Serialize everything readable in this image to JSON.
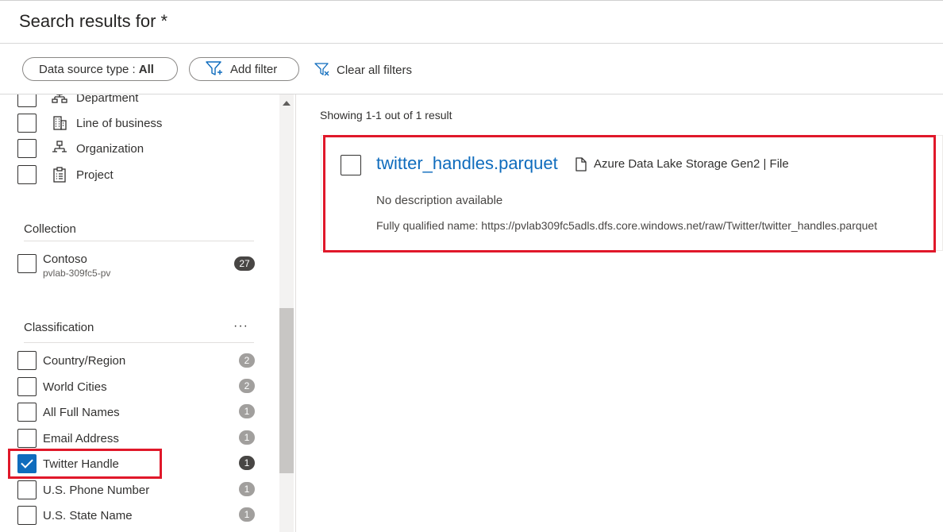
{
  "header": {
    "title": "Search results for *"
  },
  "toolbar": {
    "data_source_label": "Data source type : ",
    "data_source_value": "All",
    "add_filter": "Add filter",
    "clear_filters": "Clear all filters"
  },
  "sidebar": {
    "glossary_items": [
      {
        "label": "Department",
        "icon": "hierarchy-icon"
      },
      {
        "label": "Line of business",
        "icon": "building-icon"
      },
      {
        "label": "Organization",
        "icon": "org-chart-icon"
      },
      {
        "label": "Project",
        "icon": "clipboard-icon"
      }
    ],
    "collection": {
      "heading": "Collection",
      "items": [
        {
          "name": "Contoso",
          "sub": "pvlab-309fc5-pv",
          "count": "27"
        }
      ]
    },
    "classification": {
      "heading": "Classification",
      "more": "···",
      "items": [
        {
          "label": "Country/Region",
          "count": "2",
          "checked": false
        },
        {
          "label": "World Cities",
          "count": "2",
          "checked": false
        },
        {
          "label": "All Full Names",
          "count": "1",
          "checked": false
        },
        {
          "label": "Email Address",
          "count": "1",
          "checked": false
        },
        {
          "label": "Twitter Handle",
          "count": "1",
          "checked": true
        },
        {
          "label": "U.S. Phone Number",
          "count": "1",
          "checked": false
        },
        {
          "label": "U.S. State Name",
          "count": "1",
          "checked": false
        }
      ]
    }
  },
  "results": {
    "showing": "Showing 1-1 out of 1 result",
    "items": [
      {
        "name": "twitter_handles.parquet",
        "type": "Azure Data Lake Storage Gen2 | File",
        "description": "No description available",
        "fqn": "Fully qualified name: https://pvlab309fc5adls.dfs.core.windows.net/raw/Twitter/twitter_handles.parquet"
      }
    ]
  },
  "colors": {
    "accent": "#0f6cbd",
    "highlight": "#e0182a",
    "badge": "#a19f9d",
    "badge_active": "#484644"
  }
}
